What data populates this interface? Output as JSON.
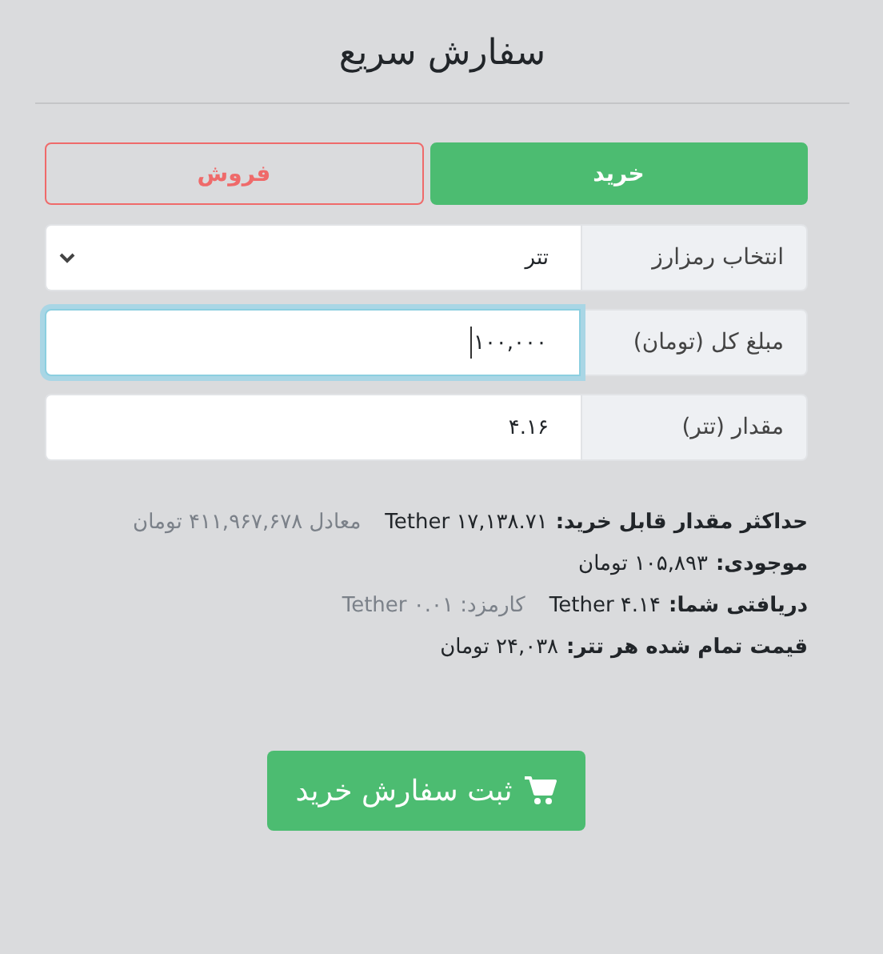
{
  "title": "سفارش سریع",
  "tabs": [
    {
      "label": "خرید",
      "kind": "buy",
      "selected": true
    },
    {
      "label": "فروش",
      "kind": "sell",
      "selected": false
    }
  ],
  "fields": [
    {
      "label": "انتخاب رمزارز",
      "kind": "select",
      "value": "تتر",
      "focused": false
    },
    {
      "label": "مبلغ کل (تومان)",
      "kind": "input",
      "value": "۱۰۰,۰۰۰",
      "focused": true
    },
    {
      "label": "مقدار (تتر)",
      "kind": "input",
      "value": "۴.۱۶",
      "focused": false
    }
  ],
  "info": [
    {
      "label": "حداکثر مقدار قابل خرید:",
      "value": "Tether ۱۷,۱۳۸.۷۱",
      "note": "معادل ۴۱۱,۹۶۷,۶۷۸ تومان"
    },
    {
      "label": "موجودی:",
      "value": "۱۰۵,۸۹۳ تومان"
    },
    {
      "label": "دریافتی شما:",
      "value": "Tether ۴.۱۴",
      "note": "کارمزد: ۰.۰۱ Tether"
    },
    {
      "label": "قیمت تمام شده هر تتر:",
      "value": "۲۴,۰۳۸ تومان"
    }
  ],
  "submit": {
    "label": "ثبت سفارش خرید"
  }
}
